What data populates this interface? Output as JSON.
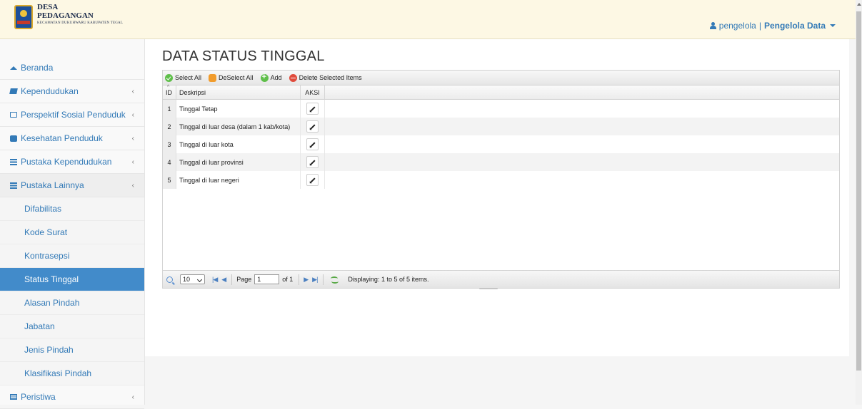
{
  "brand": {
    "line1": "DESA",
    "line2": "PEDAGANGAN",
    "line3": "KECAMATAN DUKUHWARU KABUPATEN TEGAL"
  },
  "user": {
    "username": "pengelola",
    "separator": "|",
    "role": "Pengelola Data"
  },
  "sidebar": {
    "items": [
      {
        "label": "Beranda",
        "icon": "home-icon"
      },
      {
        "label": "Kependudukan",
        "icon": "book-icon",
        "arrow": "‹"
      },
      {
        "label": "Perspektif Sosial Penduduk",
        "icon": "desktop-icon",
        "arrow": "‹"
      },
      {
        "label": "Kesehatan Penduduk",
        "icon": "medkit-icon",
        "arrow": "‹"
      },
      {
        "label": "Pustaka Kependudukan",
        "icon": "list-icon",
        "arrow": "‹"
      },
      {
        "label": "Pustaka Lainnya",
        "icon": "list-icon",
        "arrow": "‹"
      },
      {
        "label": "Peristiwa",
        "icon": "newspaper-icon",
        "arrow": "‹"
      }
    ],
    "subitems": [
      "Difabilitas",
      "Kode Surat",
      "Kontrasepsi",
      "Status Tinggal",
      "Alasan Pindah",
      "Jabatan",
      "Jenis Pindah",
      "Klasifikasi Pindah"
    ],
    "active_subitem": "Status Tinggal"
  },
  "page": {
    "title": "DATA STATUS TINGGAL"
  },
  "toolbar": {
    "select_all": "Select All",
    "deselect_all": "DeSelect All",
    "add": "Add",
    "delete_selected": "Delete Selected Items"
  },
  "table": {
    "headers": {
      "id": "ID",
      "deskripsi": "Deskripsi",
      "aksi": "AKSI"
    },
    "rows": [
      {
        "id": "1",
        "deskripsi": "Tinggal Tetap"
      },
      {
        "id": "2",
        "deskripsi": "Tinggal di luar desa (dalam 1 kab/kota)"
      },
      {
        "id": "3",
        "deskripsi": "Tinggal di luar kota"
      },
      {
        "id": "4",
        "deskripsi": "Tinggal di luar provinsi"
      },
      {
        "id": "5",
        "deskripsi": "Tinggal di luar negeri"
      }
    ]
  },
  "pager": {
    "page_size": "10",
    "page_label": "Page",
    "page_value": "1",
    "of_label": "of 1",
    "displaying": "Displaying: 1 to 5 of 5 items."
  }
}
